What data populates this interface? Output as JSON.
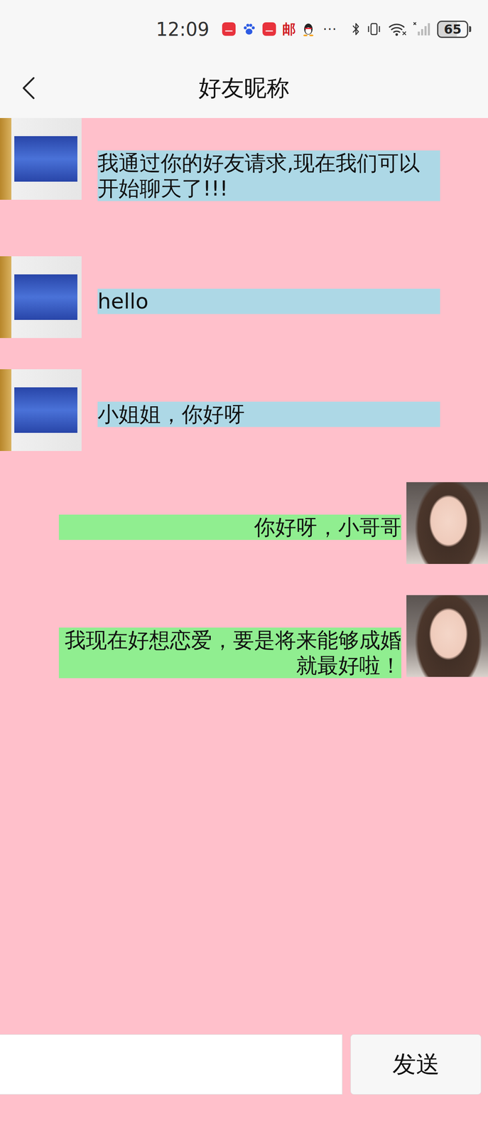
{
  "status_bar": {
    "time": "12:09",
    "notification_icons": [
      {
        "kind": "huawei"
      },
      {
        "kind": "baidu"
      },
      {
        "kind": "huawei"
      },
      {
        "kind": "glyph",
        "glyph": "邮"
      },
      {
        "kind": "qq"
      }
    ],
    "more": "···",
    "battery": "65"
  },
  "header": {
    "title": "好友昵称"
  },
  "messages": [
    {
      "kind": "received",
      "text": "我通过你的好友请求,现在我们可以开始聊天了!!!"
    },
    {
      "kind": "received",
      "text": "hello"
    },
    {
      "kind": "received",
      "text": "小姐姐，你好呀"
    },
    {
      "kind": "sent",
      "text": "你好呀，小哥哥"
    },
    {
      "kind": "sent",
      "text": "我现在好想恋爱，要是将来能够成婚就最好啦！"
    }
  ],
  "input": {
    "send": "发送"
  }
}
